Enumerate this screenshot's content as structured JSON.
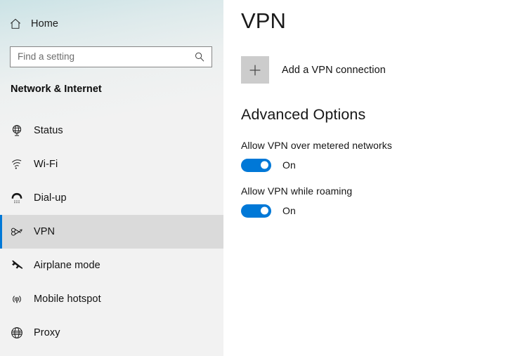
{
  "sidebar": {
    "home": {
      "label": "Home",
      "icon": "home-icon"
    },
    "search": {
      "value": "",
      "placeholder": "Find a setting",
      "icon": "search-icon"
    },
    "category_heading": "Network & Internet",
    "selected_index": 3,
    "accent_color": "#0078d7",
    "selected_background": "#dadada",
    "background": "#f2f2f2",
    "items": [
      {
        "label": "Status",
        "icon": "globe-monitor-icon",
        "selected": false
      },
      {
        "label": "Wi-Fi",
        "icon": "wifi-icon",
        "selected": false
      },
      {
        "label": "Dial-up",
        "icon": "phone-handset-icon",
        "selected": false
      },
      {
        "label": "VPN",
        "icon": "vpn-key-icon",
        "selected": true
      },
      {
        "label": "Airplane mode",
        "icon": "airplane-icon",
        "selected": false
      },
      {
        "label": "Mobile hotspot",
        "icon": "broadcast-icon",
        "selected": false
      },
      {
        "label": "Proxy",
        "icon": "globe-icon",
        "selected": false
      }
    ]
  },
  "content": {
    "title": "VPN",
    "add_connection": {
      "label": "Add a VPN connection",
      "icon": "plus-icon",
      "button_color": "#cccccc"
    },
    "advanced_options": {
      "title": "Advanced Options",
      "options": [
        {
          "label": "Allow VPN over metered networks",
          "state": "On",
          "on": true
        },
        {
          "label": "Allow VPN while roaming",
          "state": "On",
          "on": true
        }
      ]
    }
  }
}
